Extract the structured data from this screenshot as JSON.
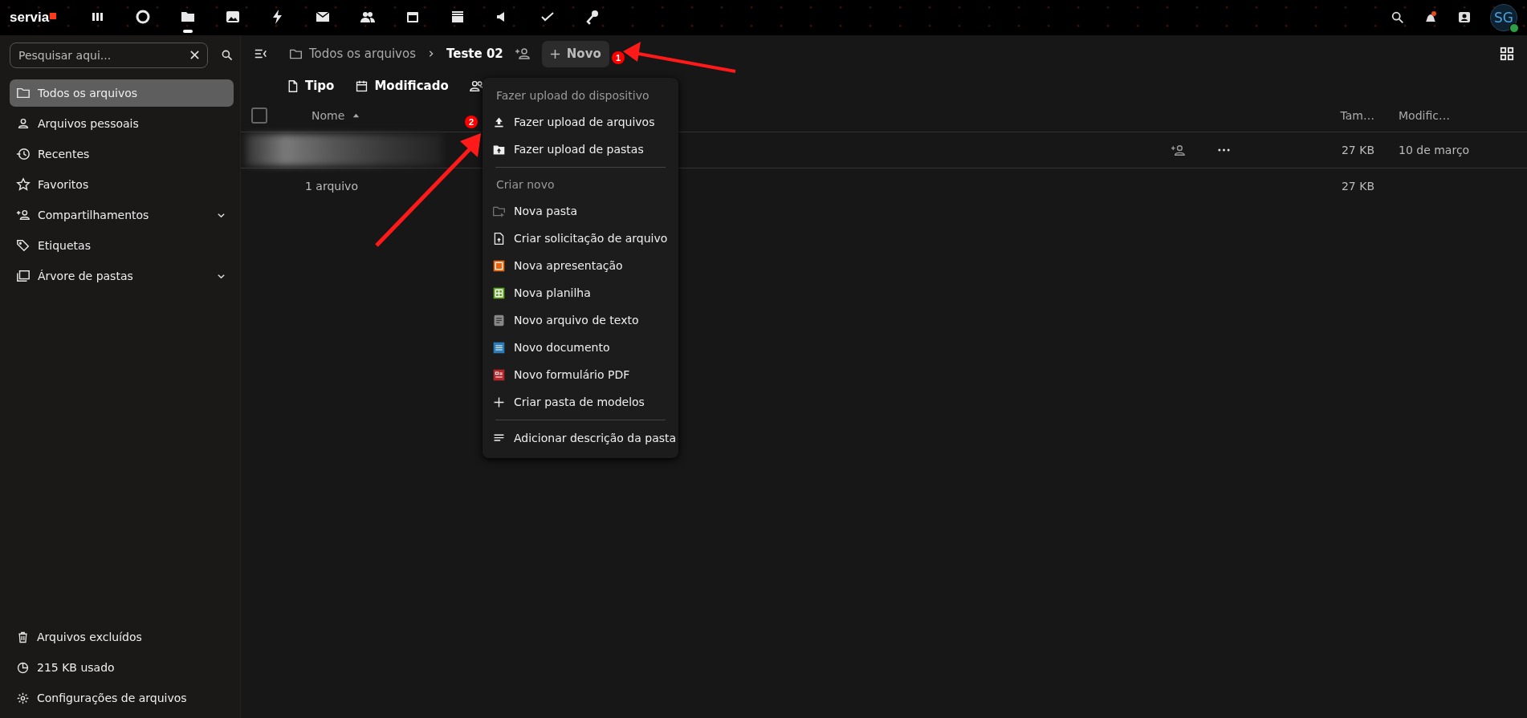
{
  "top_bar": {
    "logo": "servia",
    "apps": [
      {
        "selected": false
      },
      {
        "selected": false
      },
      {
        "selected": true
      },
      {
        "selected": false
      },
      {
        "selected": false
      },
      {
        "selected": false
      },
      {
        "selected": false
      },
      {
        "selected": false
      },
      {
        "selected": false
      },
      {
        "selected": false
      },
      {
        "selected": false
      },
      {
        "selected": false
      }
    ],
    "avatar": {
      "initials": "SG"
    }
  },
  "sidebar": {
    "search": {
      "placeholder": "Pesquisar aqui..."
    },
    "items": [
      {
        "label": "Todos os arquivos",
        "selected": true,
        "expandable": false
      },
      {
        "label": "Arquivos pessoais",
        "selected": false,
        "expandable": false
      },
      {
        "label": "Recentes",
        "selected": false,
        "expandable": false
      },
      {
        "label": "Favoritos",
        "selected": false,
        "expandable": false
      },
      {
        "label": "Compartilhamentos",
        "selected": false,
        "expandable": true
      },
      {
        "label": "Etiquetas",
        "selected": false,
        "expandable": false
      },
      {
        "label": "Árvore de pastas",
        "selected": false,
        "expandable": true
      }
    ],
    "footer": [
      "Arquivos excluídos",
      "215 KB usado",
      "Configurações de arquivos"
    ]
  },
  "breadcrumbs": {
    "root": "Todos os arquivos",
    "current": "Teste 02"
  },
  "new_button": "Novo",
  "filters": [
    "Tipo",
    "Modificado"
  ],
  "table": {
    "select_all": {
      "checked": false
    },
    "columns": [
      "Nome",
      "Tam…",
      "Modific…"
    ],
    "rows": [
      {
        "size": "27 KB",
        "modified": "10 de março"
      }
    ],
    "summary": {
      "count": "1 arquivo",
      "size": "27 KB"
    }
  },
  "menu": {
    "sections": [
      {
        "heading": "Fazer upload do dispositivo",
        "items": [
          "Fazer upload de arquivos",
          "Fazer upload de pastas"
        ]
      },
      {
        "heading": "Criar novo",
        "items": [
          "Nova pasta",
          "Criar solicitação de arquivo",
          "Nova apresentação",
          "Nova planilha",
          "Novo arquivo de texto",
          "Novo documento",
          "Novo formulário PDF",
          "Criar pasta de modelos"
        ]
      },
      {
        "items": [
          "Adicionar descrição da pasta"
        ]
      }
    ]
  },
  "annotations": [
    {
      "label": "1"
    },
    {
      "label": "2"
    }
  ]
}
